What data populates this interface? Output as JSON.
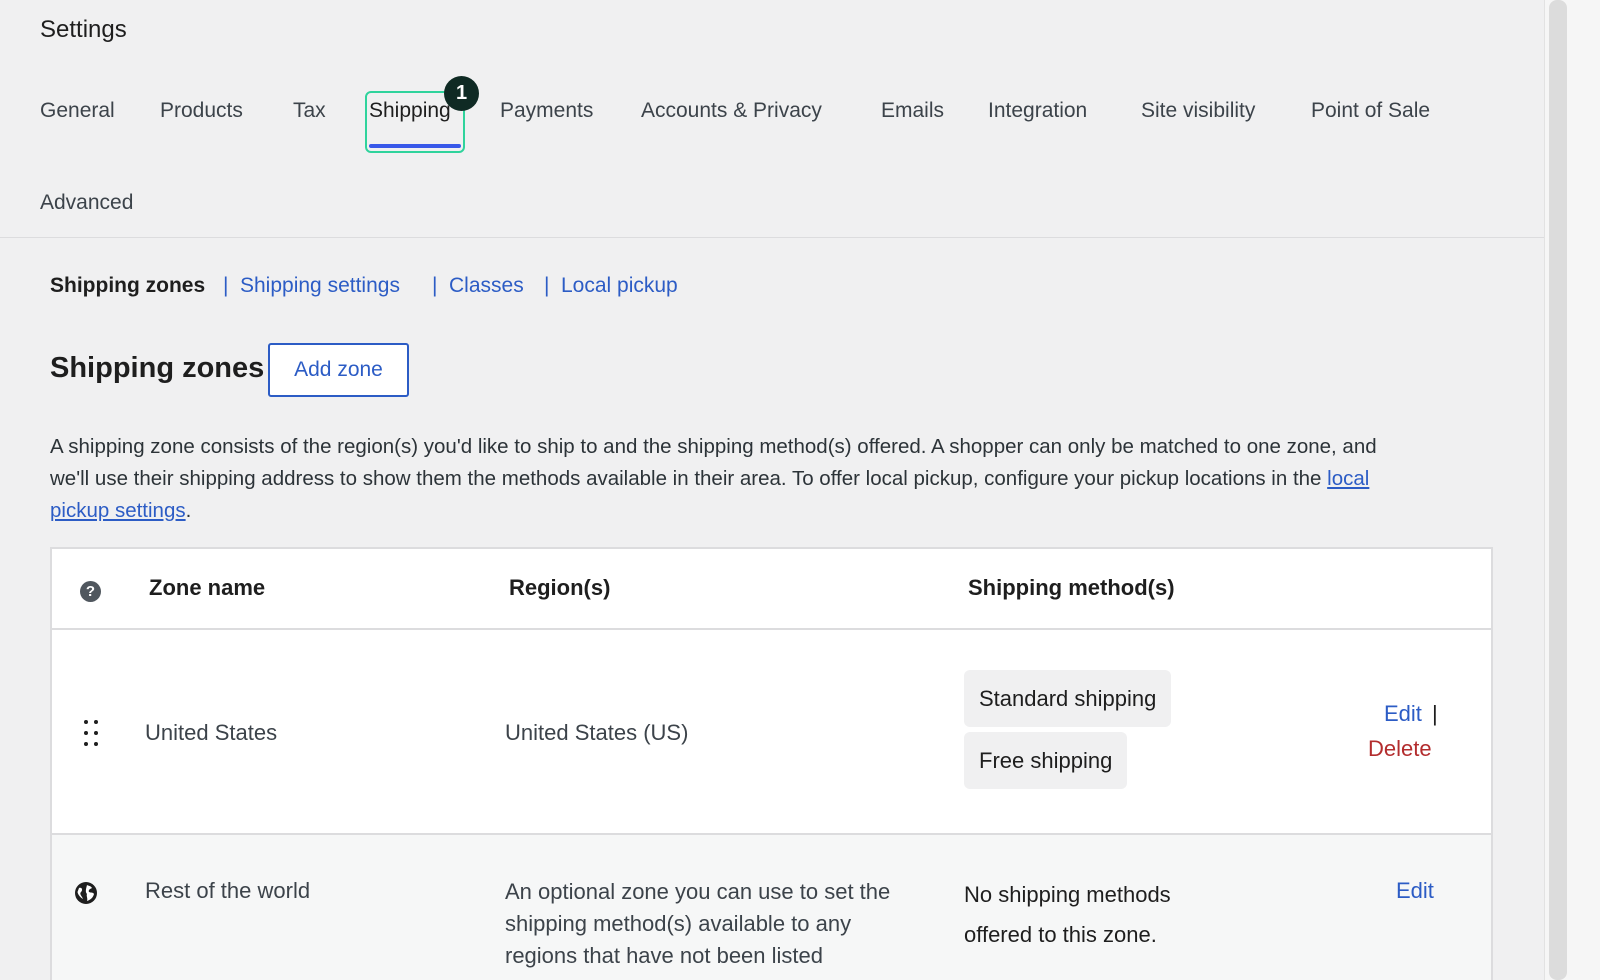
{
  "header": {
    "title": "Settings"
  },
  "tabs": [
    {
      "label": "General"
    },
    {
      "label": "Products"
    },
    {
      "label": "Tax"
    },
    {
      "label": "Shipping",
      "active": true,
      "badge": "1"
    },
    {
      "label": "Payments"
    },
    {
      "label": "Accounts & Privacy"
    },
    {
      "label": "Emails"
    },
    {
      "label": "Integration"
    },
    {
      "label": "Site visibility"
    },
    {
      "label": "Point of Sale"
    },
    {
      "label": "Advanced"
    }
  ],
  "subnav": {
    "current": "Shipping zones",
    "separator": "|",
    "links": [
      "Shipping settings",
      "Classes",
      "Local pickup"
    ]
  },
  "section": {
    "title": "Shipping zones",
    "add_zone_label": "Add zone",
    "description_text": "A shipping zone consists of the region(s) you'd like to ship to and the shipping method(s) offered. A shopper can only be matched to one zone, and we'll use their shipping address to show them the methods available in their area. To offer local pickup, configure your pickup locations in the ",
    "description_link": "local pickup settings",
    "description_end": "."
  },
  "table": {
    "help_icon_glyph": "?",
    "columns": [
      "Zone name",
      "Region(s)",
      "Shipping method(s)"
    ],
    "rows": [
      {
        "zone_name": "United States",
        "regions": "United States (US)",
        "methods": [
          "Standard shipping",
          "Free shipping"
        ],
        "edit_label": "Edit",
        "separator": "|",
        "delete_label": "Delete"
      },
      {
        "zone_name": "Rest of the world",
        "regions": "An optional zone you can use to set the shipping method(s) available to any regions that have not been listed",
        "methods_text": "No shipping methods offered to this zone.",
        "edit_label": "Edit"
      }
    ]
  },
  "colors": {
    "accent": "#2c5cc5",
    "active_tab_outline": "#2fd39c",
    "active_tab_underline": "#3858e9",
    "delete": "#b32d2e",
    "badge": "#0f2a24"
  },
  "icons": {
    "help": "help-icon",
    "drag": "drag-handle-icon",
    "globe": "globe-icon"
  }
}
